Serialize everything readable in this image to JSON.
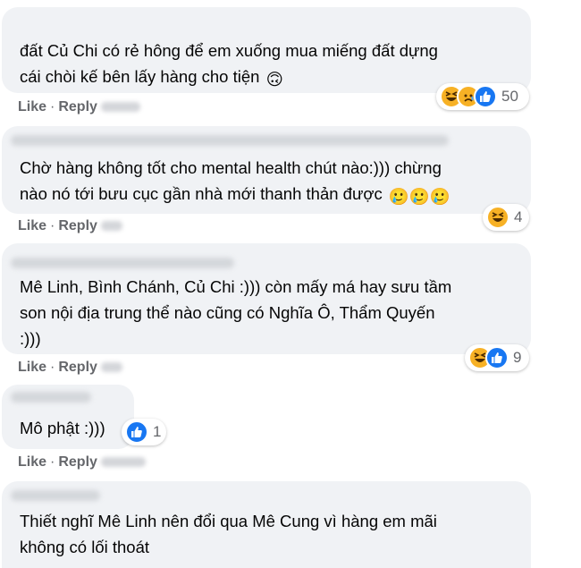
{
  "comments": [
    {
      "text": "đất Củ Chi có rẻ hông để em xuống mua miếng đất dựng\ncái chòi kế bên lấy hàng cho tiện",
      "emoji": "🙃",
      "reaction_count": "50",
      "reactions": [
        "haha-icon",
        "sad-icon",
        "like-icon"
      ]
    },
    {
      "text": "Chờ hàng không tốt cho mental health chút nào:))) chừng\nnào nó tới bưu cục gần nhà mới thanh thản được",
      "emoji": "🥲🥲🥲",
      "reaction_count": "4",
      "reactions": [
        "haha-icon"
      ]
    },
    {
      "text": "Mê Linh, Bình Chánh, Củ Chi :))) còn mấy má hay sưu tầm\nson nội địa trung thể nào cũng có Nghĩa Ô, Thẩm Quyến\n:)))",
      "emoji": "",
      "reaction_count": "9",
      "reactions": [
        "haha-icon",
        "like-icon"
      ]
    },
    {
      "text": "Mô phật :)))",
      "emoji": "",
      "reaction_count": "1",
      "reactions": [
        "like-icon"
      ]
    },
    {
      "text": "Thiết nghĩ Mê Linh nên đổi qua Mê Cung vì hàng em mãi\nkhông có lối thoát",
      "emoji": "",
      "reaction_count": "",
      "reactions": []
    }
  ],
  "actions": {
    "like": "Like",
    "reply": "Reply",
    "separator": "·"
  },
  "colors": {
    "bubble": "#f0f2f5",
    "meta": "#65676b",
    "like_blue": "#1877f2",
    "emoji_yellow": "#f7b125"
  }
}
